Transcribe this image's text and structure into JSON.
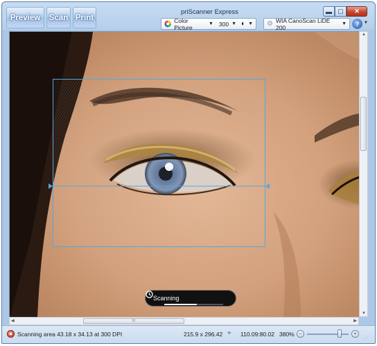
{
  "window": {
    "title": "priScanner Express"
  },
  "toolbar": {
    "preview_label": "Preview",
    "scan_label": "Scan",
    "print_label": "Print",
    "color_mode": "Color Picture",
    "dpi": "300",
    "scanner": "WIA CanoScan LiDE 200"
  },
  "scanning": {
    "label": "Scanning",
    "progress": 0.55
  },
  "status": {
    "area_text": "Scanning area 43.18 x 34.13 at 300 DPI",
    "dimensions": "215.9 x 296.42",
    "position": "110.09:80.02",
    "zoom": "380%"
  },
  "scroll": {
    "grip": "III"
  },
  "colors": {
    "selection": "#56a6dc",
    "accent": "#3f6aa0"
  }
}
